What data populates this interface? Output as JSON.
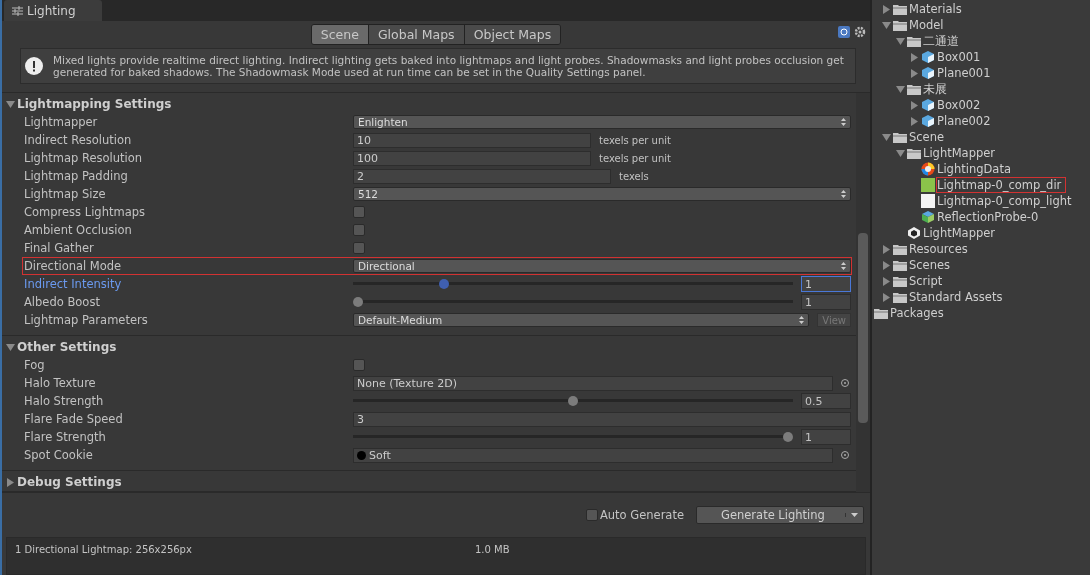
{
  "window": {
    "title": "Lighting"
  },
  "tabs": [
    {
      "label": "Scene",
      "selected": true
    },
    {
      "label": "Global Maps",
      "selected": false
    },
    {
      "label": "Object Maps",
      "selected": false
    }
  ],
  "notice": "Mixed lights provide realtime direct lighting. Indirect lighting gets baked into lightmaps and light probes. Shadowmasks and light probes occlusion get generated for baked shadows. The Shadowmask Mode used at run time can be set in the Quality Settings panel.",
  "sections": [
    {
      "title": "Lightmapping Settings",
      "expanded": true,
      "rows": [
        {
          "label": "Lightmapper",
          "kind": "dropdown",
          "value": "Enlighten"
        },
        {
          "label": "Indirect Resolution",
          "kind": "field",
          "value": "10",
          "unit": "texels per unit"
        },
        {
          "label": "Lightmap Resolution",
          "kind": "field",
          "value": "100",
          "unit": "texels per unit"
        },
        {
          "label": "Lightmap Padding",
          "kind": "field",
          "value": "2",
          "unit": "texels"
        },
        {
          "label": "Lightmap Size",
          "kind": "dropdown",
          "value": "512"
        },
        {
          "label": "Compress Lightmaps",
          "kind": "checkbox",
          "checked": false
        },
        {
          "label": "Ambient Occlusion",
          "kind": "checkbox",
          "checked": false
        },
        {
          "label": "Final Gather",
          "kind": "checkbox",
          "checked": false
        },
        {
          "label": "Directional Mode",
          "kind": "dropdown",
          "value": "Directional",
          "highlighted": true
        },
        {
          "label": "Indirect Intensity",
          "kind": "slider",
          "value": "1",
          "level": 0.2,
          "focused": true
        },
        {
          "label": "Albedo Boost",
          "kind": "slider",
          "value": "1",
          "level": 0
        },
        {
          "label": "Lightmap Parameters",
          "kind": "dropdown",
          "value": "Default-Medium",
          "button": "View"
        }
      ]
    },
    {
      "title": "Other Settings",
      "expanded": true,
      "rows": [
        {
          "label": "Fog",
          "kind": "checkbox",
          "checked": false
        },
        {
          "label": "Halo Texture",
          "kind": "object",
          "value": "None (Texture 2D)"
        },
        {
          "label": "Halo Strength",
          "kind": "slider",
          "value": "0.5",
          "level": 0.5
        },
        {
          "label": "Flare Fade Speed",
          "kind": "field",
          "value": "3"
        },
        {
          "label": "Flare Strength",
          "kind": "slider",
          "value": "1",
          "level": 1
        },
        {
          "label": "Spot Cookie",
          "kind": "object",
          "value": "Soft",
          "swatch": true
        }
      ]
    },
    {
      "title": "Debug Settings",
      "expanded": false
    }
  ],
  "auto_generate": {
    "label": "Auto Generate",
    "checked": false
  },
  "generate_button": "Generate Lighting",
  "stats": [
    {
      "label": "1 Directional Lightmap: 256x256px",
      "size": "1.0 MB"
    }
  ],
  "tree": [
    {
      "name": "Materials",
      "kind": "folder",
      "expanded": false
    },
    {
      "name": "Model",
      "kind": "folder",
      "expanded": true,
      "children": [
        {
          "name": "二通道",
          "kind": "folder",
          "expanded": true,
          "children": [
            {
              "name": "Box001",
              "kind": "mesh",
              "expanded": false
            },
            {
              "name": "Plane001",
              "kind": "mesh",
              "expanded": false
            }
          ]
        },
        {
          "name": "未展",
          "kind": "folder",
          "expanded": true,
          "children": [
            {
              "name": "Box002",
              "kind": "mesh",
              "expanded": false
            },
            {
              "name": "Plane002",
              "kind": "mesh",
              "expanded": false
            }
          ]
        }
      ]
    },
    {
      "name": "Scene",
      "kind": "folder",
      "expanded": true,
      "children": [
        {
          "name": "LightMapper",
          "kind": "folder",
          "expanded": true,
          "children": [
            {
              "name": "LightingData",
              "kind": "lighting-data"
            },
            {
              "name": "Lightmap-0_comp_dir",
              "kind": "texture",
              "color": "#8bc34a",
              "highlighted": true
            },
            {
              "name": "Lightmap-0_comp_light",
              "kind": "texture",
              "color": "#f4f4f4"
            },
            {
              "name": "ReflectionProbe-0",
              "kind": "probe"
            }
          ]
        },
        {
          "name": "LightMapper",
          "kind": "scene"
        }
      ]
    },
    {
      "name": "Resources",
      "kind": "folder",
      "expanded": false
    },
    {
      "name": "Scenes",
      "kind": "folder",
      "expanded": false
    },
    {
      "name": "Script",
      "kind": "folder",
      "expanded": false
    },
    {
      "name": "Standard Assets",
      "kind": "folder",
      "expanded": false
    },
    {
      "name": "Packages",
      "kind": "root"
    }
  ]
}
